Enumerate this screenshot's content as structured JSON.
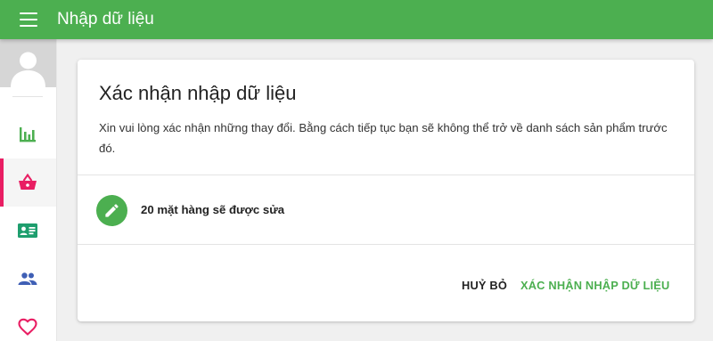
{
  "header": {
    "title": "Nhập dữ liệu"
  },
  "sidebar": {
    "items": [
      {
        "name": "stats",
        "icon": "bar-chart-icon",
        "color": "#4caf50"
      },
      {
        "name": "products",
        "icon": "shopping-basket-icon",
        "color": "#e91e63",
        "active": true
      },
      {
        "name": "customers",
        "icon": "contact-card-icon",
        "color": "#1e9e6e"
      },
      {
        "name": "users",
        "icon": "group-icon",
        "color": "#3f5fb5"
      },
      {
        "name": "favorites",
        "icon": "heart-icon",
        "color": "#e91e63"
      }
    ]
  },
  "dialog": {
    "title": "Xác nhận nhập dữ liệu",
    "description": "Xin vui lòng xác nhận những thay đổi. Bằng cách tiếp tục bạn sẽ không thể trở về danh sách sản phẩm trước đó.",
    "summary_icon": "pencil-icon",
    "summary_text": "20 mặt hàng sẽ được sửa",
    "cancel_label": "HUỶ BỎ",
    "confirm_label": "XÁC NHẬN NHẬP DỮ LIỆU"
  },
  "colors": {
    "primary": "#4caf50",
    "accent": "#e91e63"
  }
}
